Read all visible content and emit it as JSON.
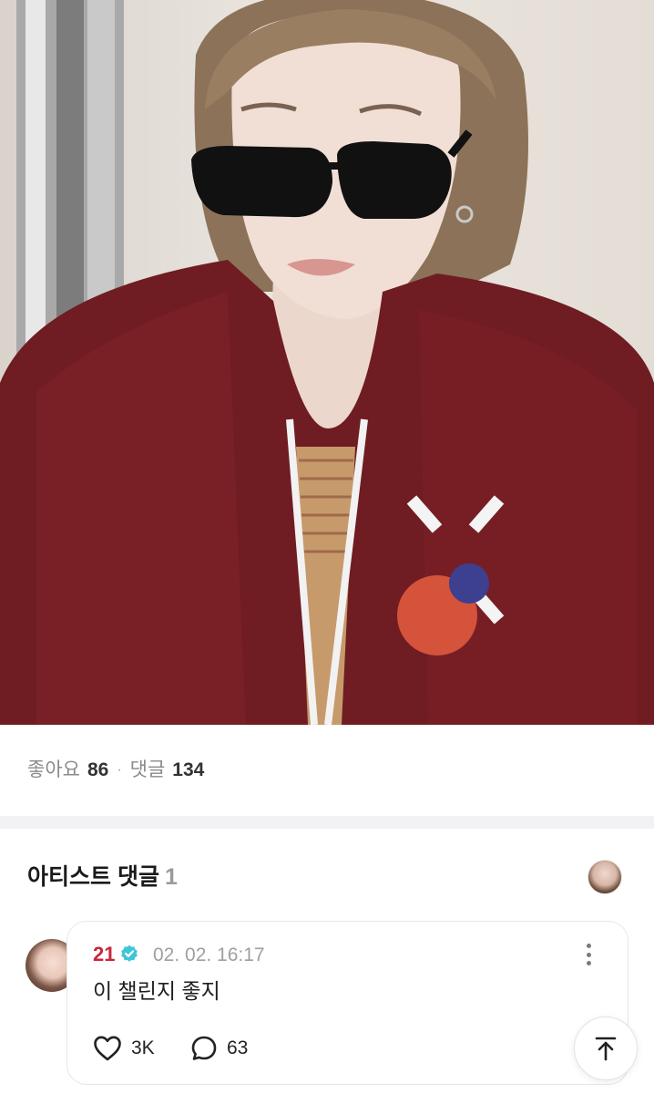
{
  "post": {
    "photo_alt": "photo",
    "likes_label": "좋아요",
    "likes_count": "86",
    "separator": "·",
    "comments_label": "댓글",
    "comments_count": "134"
  },
  "artist_comments": {
    "title": "아티스트 댓글",
    "count": "1"
  },
  "comment": {
    "author": "21",
    "timestamp": "02. 02. 16:17",
    "text": "이 챌린지 좋지",
    "like_count": "3K",
    "reply_count": "63"
  },
  "colors": {
    "author_name": "#c8283a",
    "verified_badge": "#3ec6d8",
    "divider": "#f2f2f4",
    "muted_text": "#8a8a8a"
  },
  "icons": {
    "verified": "verified-badge-icon",
    "more": "more-vertical-icon",
    "like": "heart-icon",
    "reply": "comment-bubble-icon",
    "scroll_top": "arrow-up-icon"
  }
}
